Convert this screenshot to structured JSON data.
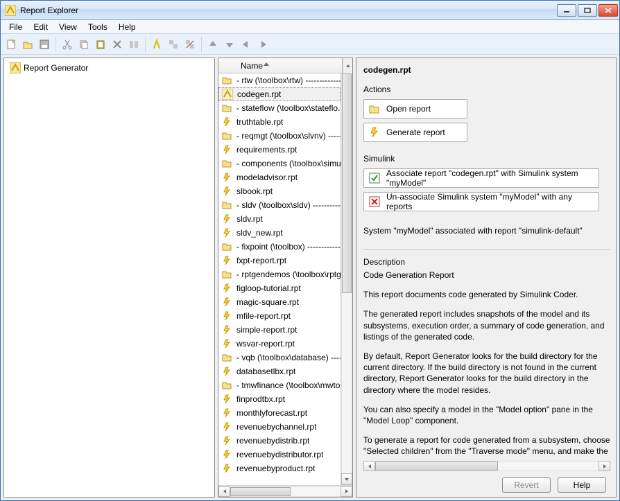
{
  "window": {
    "title": "Report Explorer"
  },
  "menu": {
    "items": [
      "File",
      "Edit",
      "View",
      "Tools",
      "Help"
    ]
  },
  "left": {
    "root": "Report Generator"
  },
  "middle": {
    "column": "Name",
    "items": [
      {
        "type": "folder",
        "label": "-  rtw (\\toolbox\\rtw)  -------------"
      },
      {
        "type": "rpt-sel",
        "label": "codegen.rpt"
      },
      {
        "type": "folder",
        "label": "-  stateflow (\\toolbox\\stateflo..."
      },
      {
        "type": "rpt",
        "label": "truthtable.rpt"
      },
      {
        "type": "folder",
        "label": "-  reqmgt (\\toolbox\\slvnv)  -----"
      },
      {
        "type": "rpt",
        "label": "requirements.rpt"
      },
      {
        "type": "folder",
        "label": "-  components (\\toolbox\\simul..."
      },
      {
        "type": "rpt",
        "label": "modeladvisor.rpt"
      },
      {
        "type": "rpt",
        "label": "slbook.rpt"
      },
      {
        "type": "folder",
        "label": "-  sldv (\\toolbox\\sldv)  ------------"
      },
      {
        "type": "rpt",
        "label": "sldv.rpt"
      },
      {
        "type": "rpt",
        "label": "sldv_new.rpt"
      },
      {
        "type": "folder",
        "label": "-  fixpoint (\\toolbox)  -------------"
      },
      {
        "type": "rpt",
        "label": "fxpt-report.rpt"
      },
      {
        "type": "folder",
        "label": "-  rptgendemos (\\toolbox\\rptg..."
      },
      {
        "type": "rpt",
        "label": "figloop-tutorial.rpt"
      },
      {
        "type": "rpt",
        "label": "magic-square.rpt"
      },
      {
        "type": "rpt",
        "label": "mfile-report.rpt"
      },
      {
        "type": "rpt",
        "label": "simple-report.rpt"
      },
      {
        "type": "rpt",
        "label": "wsvar-report.rpt"
      },
      {
        "type": "folder",
        "label": "-  vqb (\\toolbox\\database)  -----"
      },
      {
        "type": "rpt",
        "label": "databasetlbx.rpt"
      },
      {
        "type": "folder",
        "label": "-  tmwfinance (\\toolbox\\mwto..."
      },
      {
        "type": "rpt",
        "label": "finprodtbx.rpt"
      },
      {
        "type": "rpt",
        "label": "monthlyforecast.rpt"
      },
      {
        "type": "rpt",
        "label": "revenuebychannel.rpt"
      },
      {
        "type": "rpt",
        "label": "revenuebydistrib.rpt"
      },
      {
        "type": "rpt",
        "label": "revenuebydistributor.rpt"
      },
      {
        "type": "rpt",
        "label": "revenuebyproduct.rpt"
      }
    ]
  },
  "right": {
    "title": "codegen.rpt",
    "sections": {
      "actions_label": "Actions",
      "open_report": "Open report",
      "generate_report": "Generate report",
      "simulink_label": "Simulink",
      "associate": "Associate report \"codegen.rpt\" with Simulink system \"myModel\"",
      "unassociate": "Un-associate Simulink system \"myModel\" with any reports",
      "status": "System \"myModel\" associated with report \"simulink-default\"",
      "description_label": "Description",
      "desc_title": "Code Generation Report",
      "desc_p1": "This report documents code generated by Simulink Coder.",
      "desc_p2": "The generated report includes snapshots of the model and its subsystems, execution order, a summary of code generation, and listings of the generated code.",
      "desc_p3": "By default, Report Generator looks for the build directory for the current directory. If the build directory is not found in the current directory, Report Generator looks for the build directory in the directory where the model resides.",
      "desc_p4": "You can also specify a model in the \"Model option\" pane in the \"Model Loop\" component.",
      "desc_p5": "To generate a report for code generated from a subsystem, choose \"Selected children\" from the \"Traverse mode\" menu, and make the source subsystem the current system or name the source subsystem  in the \"Starting system(s)\" option."
    },
    "buttons": {
      "revert": "Revert",
      "help": "Help"
    }
  }
}
